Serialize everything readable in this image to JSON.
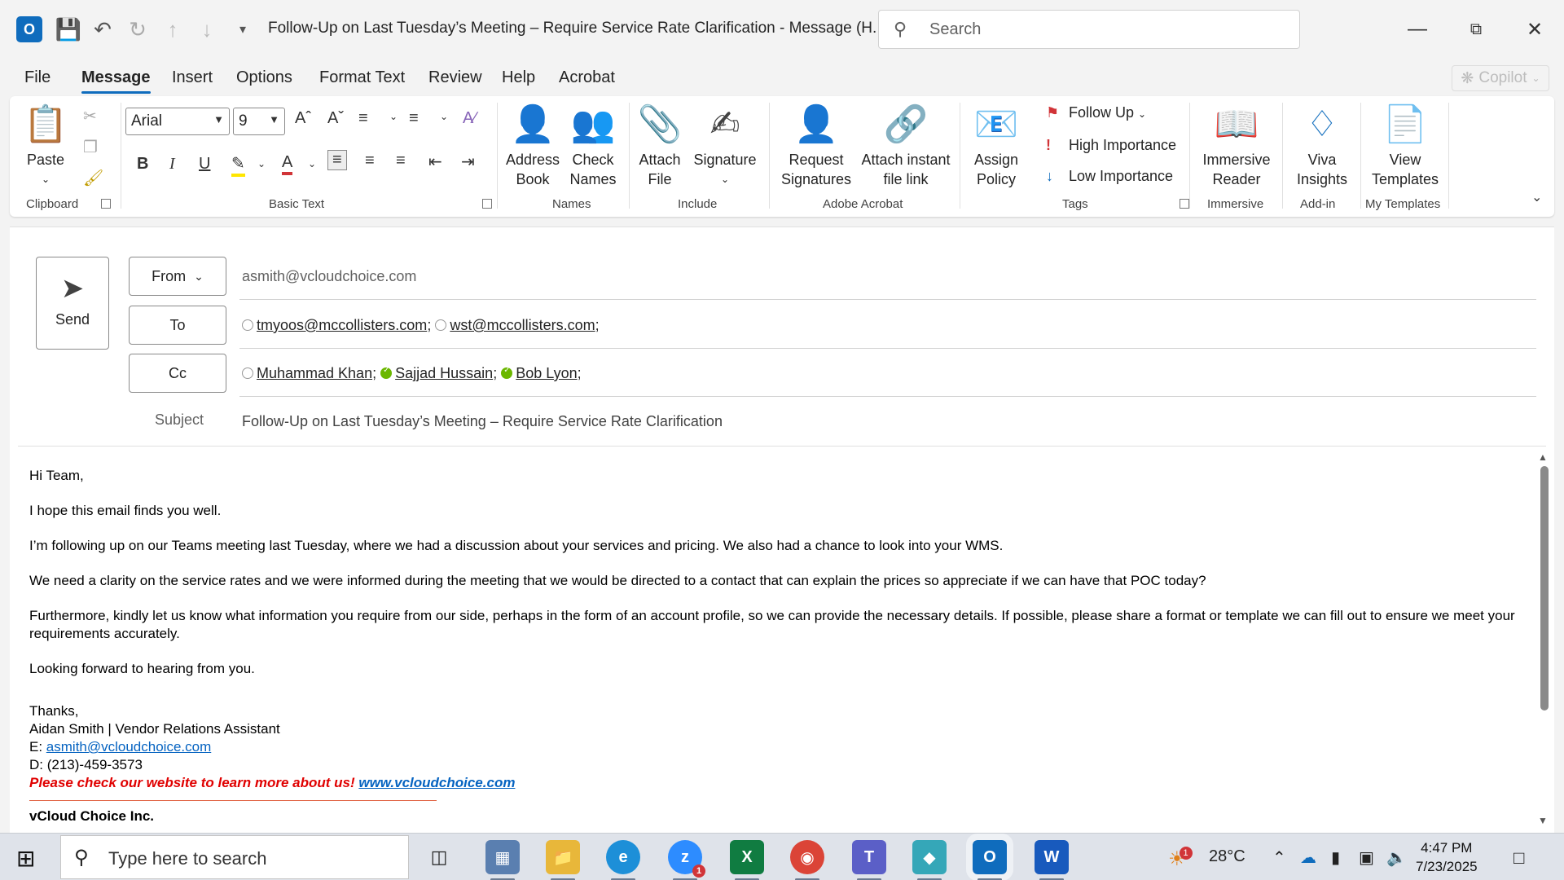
{
  "window": {
    "title": "Follow-Up on Last Tuesday’s Meeting – Require Service Rate Clarification  -  Message (H...",
    "search_placeholder": "Search"
  },
  "menu_tabs": [
    "File",
    "Message",
    "Insert",
    "Options",
    "Format Text",
    "Review",
    "Help",
    "Acrobat"
  ],
  "copilot_label": "Copilot",
  "ribbon": {
    "clipboard": {
      "paste": "Paste",
      "group": "Clipboard"
    },
    "basic_text": {
      "font": "Arial",
      "size": "9",
      "group": "Basic Text"
    },
    "names": {
      "address_book_1": "Address",
      "address_book_2": "Book",
      "check_names_1": "Check",
      "check_names_2": "Names",
      "group": "Names"
    },
    "include": {
      "attach_1": "Attach",
      "attach_2": "File",
      "signature": "Signature",
      "group": "Include"
    },
    "acrobat": {
      "req_1": "Request",
      "req_2": "Signatures",
      "link_1": "Attach instant",
      "link_2": "file link",
      "group": "Adobe Acrobat"
    },
    "tags": {
      "assign_1": "Assign",
      "assign_2": "Policy",
      "follow_up": "Follow Up",
      "high": "High Importance",
      "low": "Low Importance",
      "group": "Tags"
    },
    "immersive": {
      "label_1": "Immersive",
      "label_2": "Reader",
      "group": "Immersive"
    },
    "addin": {
      "label_1": "Viva",
      "label_2": "Insights",
      "group": "Add-in"
    },
    "templates": {
      "label_1": "View",
      "label_2": "Templates",
      "group": "My Templates"
    }
  },
  "compose": {
    "send": "Send",
    "from_label": "From",
    "from_value": "asmith@vcloudchoice.com",
    "to_label": "To",
    "to": [
      {
        "name": "tmyoos@mccollisters.com",
        "online": false
      },
      {
        "name": "wst@mccollisters.com",
        "online": false
      }
    ],
    "cc_label": "Cc",
    "cc": [
      {
        "name": "Muhammad Khan",
        "online": false
      },
      {
        "name": "Sajjad Hussain",
        "online": true
      },
      {
        "name": "Bob Lyon",
        "online": true
      }
    ],
    "subject_label": "Subject",
    "subject": "Follow-Up on Last Tuesday’s Meeting – Require Service Rate Clarification"
  },
  "body": {
    "greeting": "Hi Team,",
    "p1": "I hope this email finds you well.",
    "p2": "I’m following up on our Teams meeting last Tuesday, where we had a discussion about your services and pricing. We also had a chance to look into your WMS.",
    "p3": "We need a clarity on the service rates and we were informed during the meeting that we would be directed to a contact that can explain the prices so appreciate if we can have that POC today?",
    "p4": "Furthermore, kindly let us know what information you require from our side, perhaps in the form of an account profile, so we can provide the necessary details. If possible, please share a format or template we can fill out to ensure we meet your requirements accurately.",
    "p5": "Looking forward to hearing from you.",
    "sig_thanks": "Thanks,",
    "sig_name": "Aidan Smith | Vendor Relations Assistant",
    "sig_email_prefix": "E: ",
    "sig_email": "asmith@vcloudchoice.com",
    "sig_phone": "D: (213)-459-3573",
    "sig_promo": "Please check our website to learn more about us!",
    "sig_site": "www.vcloudchoice.com",
    "sig_company": "vCloud Choice Inc."
  },
  "taskbar": {
    "search_placeholder": "Type here to search",
    "zoom_badge": "1",
    "weather_badge": "1",
    "temperature": "28°C",
    "time": "4:47 PM",
    "date": "7/23/2025"
  }
}
